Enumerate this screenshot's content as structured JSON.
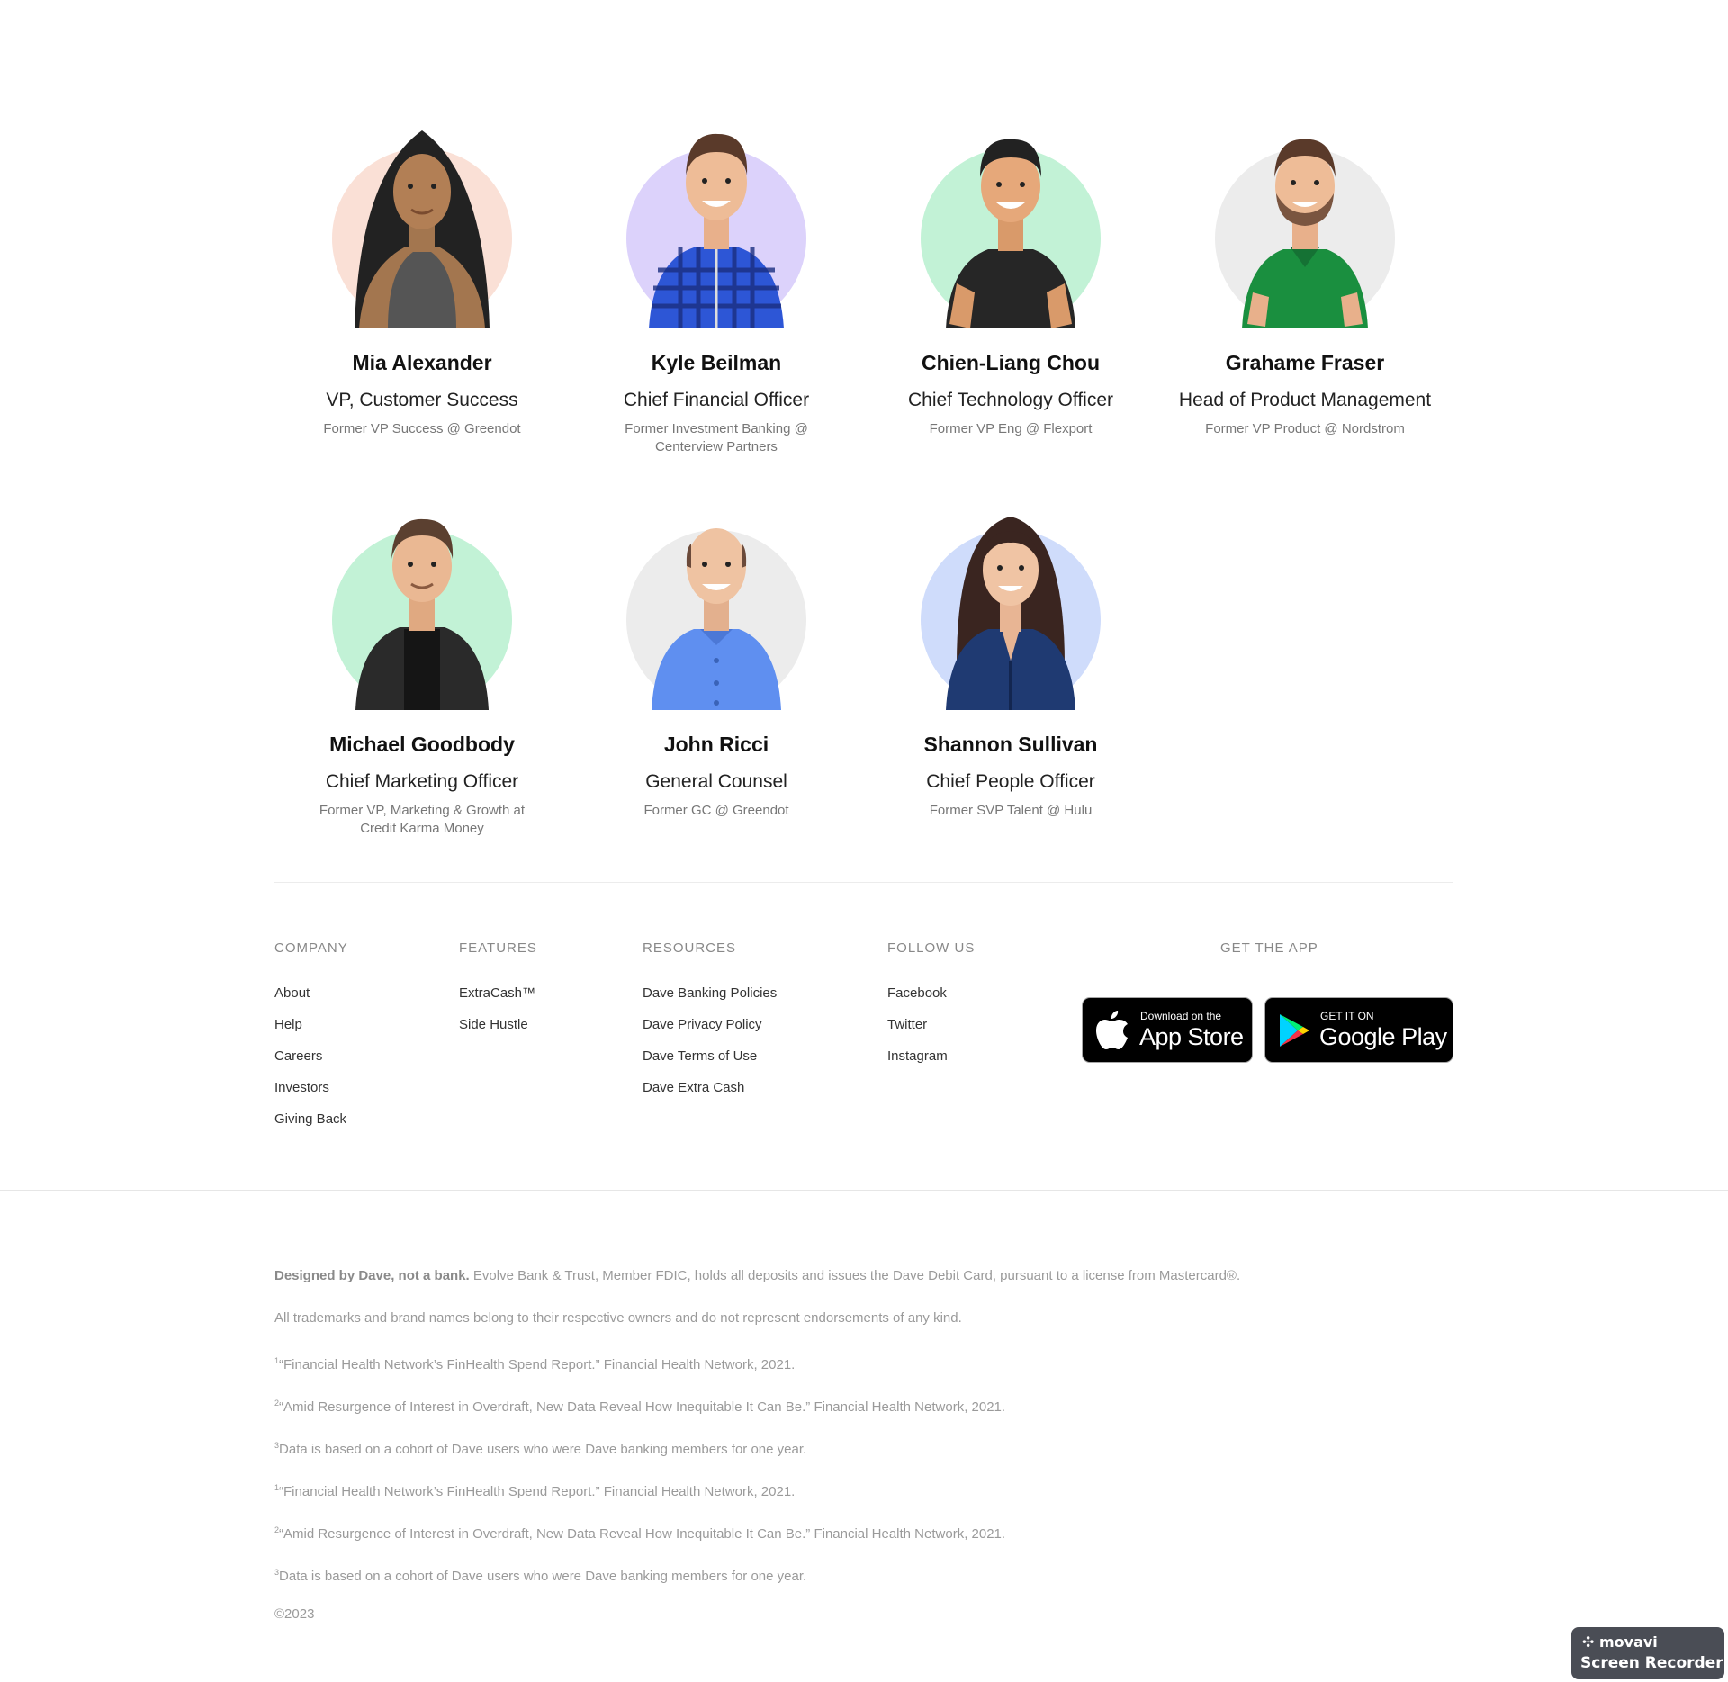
{
  "team": [
    {
      "name": "Mia Alexander",
      "role": "VP, Customer Success",
      "former": "Former VP Success @ Greendot"
    },
    {
      "name": "Kyle Beilman",
      "role": "Chief Financial Officer",
      "former": "Former Investment Banking @ Centerview Partners"
    },
    {
      "name": "Chien-Liang Chou",
      "role": "Chief Technology Officer",
      "former": "Former VP Eng @ Flexport"
    },
    {
      "name": "Grahame Fraser",
      "role": "Head of Product Management",
      "former": "Former VP Product @ Nordstrom"
    },
    {
      "name": "Michael Goodbody",
      "role": "Chief Marketing Officer",
      "former": "Former VP, Marketing & Growth at Credit Karma Money"
    },
    {
      "name": "John Ricci",
      "role": "General Counsel",
      "former": "Former GC @ Greendot"
    },
    {
      "name": "Shannon Sullivan",
      "role": "Chief People Officer",
      "former": "Former SVP Talent @ Hulu"
    }
  ],
  "avatar_colors": {
    "peach": "#fae0d6",
    "lavender": "#dcd2fb",
    "mint": "#c2f2d6",
    "gray": "#ececec",
    "sky": "#cfdcfb"
  },
  "footer": {
    "company": {
      "heading": "COMPANY",
      "links": [
        "About",
        "Help",
        "Careers",
        "Investors",
        "Giving Back"
      ]
    },
    "features": {
      "heading": "FEATURES",
      "links": [
        "ExtraCash™",
        "Side Hustle"
      ]
    },
    "resources": {
      "heading": "RESOURCES",
      "links": [
        "Dave Banking Policies",
        "Dave Privacy Policy",
        "Dave Terms of Use",
        "Dave Extra Cash"
      ]
    },
    "follow": {
      "heading": "FOLLOW US",
      "links": [
        "Facebook",
        "Twitter",
        "Instagram"
      ]
    },
    "app": {
      "heading": "GET THE APP",
      "app_store": {
        "small": "Download on the",
        "big": "App Store"
      },
      "google_play": {
        "small": "GET IT ON",
        "big": "Google Play"
      }
    }
  },
  "legal": {
    "designed_bold": "Designed by Dave, not a bank.",
    "designed_rest": " Evolve Bank & Trust, Member FDIC, holds all deposits and issues the Dave Debit Card, pursuant to a license from Mastercard®.",
    "trademarks": "All trademarks and brand names belong to their respective owners and do not represent endorsements of any kind.",
    "footnotes": [
      {
        "sup": "1",
        "text": "“Financial Health Network’s FinHealth Spend Report.” Financial Health Network, 2021."
      },
      {
        "sup": "2",
        "text": "“Amid Resurgence of Interest in Overdraft, New Data Reveal How Inequitable It Can Be.” Financial Health Network, 2021."
      },
      {
        "sup": "3",
        "text": "Data is based on a cohort of Dave users who were Dave banking members for one year."
      },
      {
        "sup": "1",
        "text": "“Financial Health Network’s FinHealth Spend Report.” Financial Health Network, 2021."
      },
      {
        "sup": "2",
        "text": "“Amid Resurgence of Interest in Overdraft, New Data Reveal How Inequitable It Can Be.” Financial Health Network, 2021."
      },
      {
        "sup": "3",
        "text": "Data is based on a cohort of Dave users who were Dave banking members for one year."
      }
    ],
    "copyright": "©2023"
  },
  "recorder": {
    "brand": "movavi",
    "product": "Screen Recorder"
  }
}
